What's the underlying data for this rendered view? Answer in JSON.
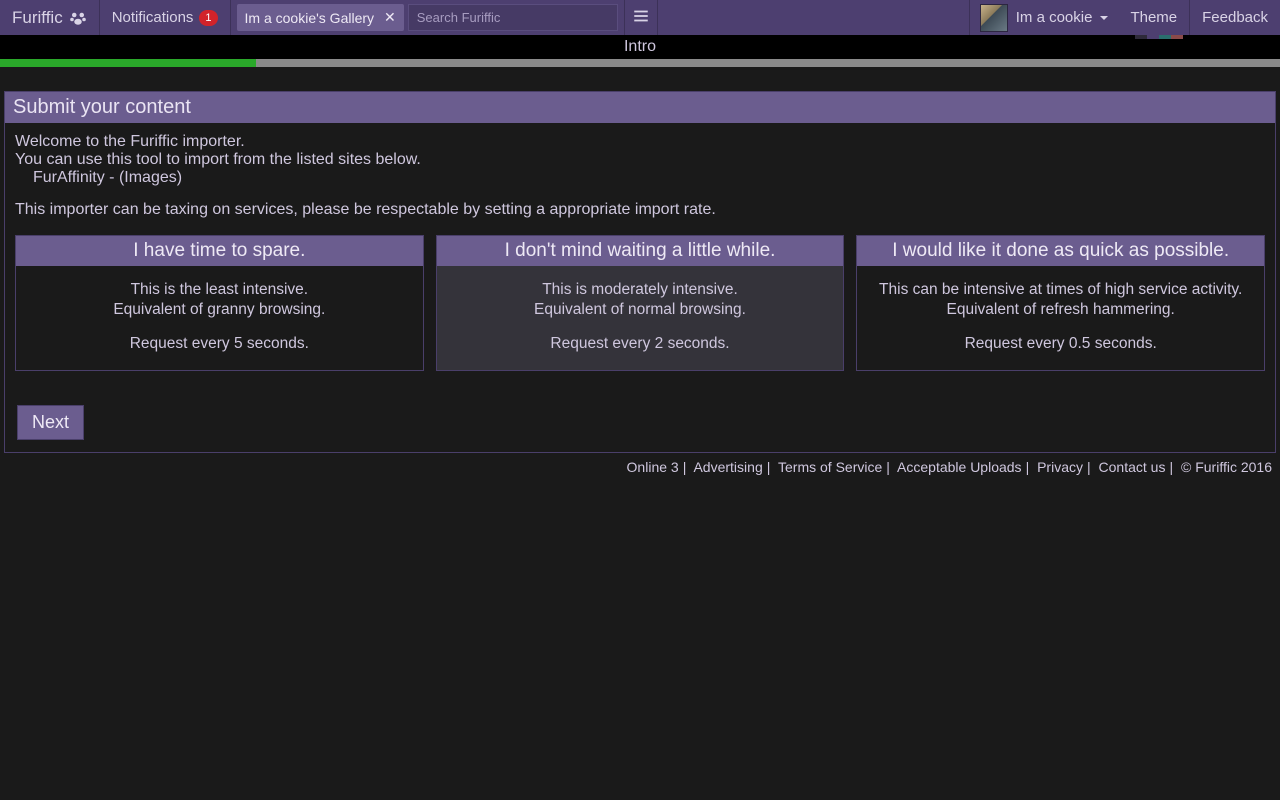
{
  "nav": {
    "brand": "Furiffic",
    "notifications_label": "Notifications",
    "notifications_count": "1",
    "tab_label": "Im a cookie's Gallery",
    "search_placeholder": "Search Furiffic",
    "username": "Im a cookie",
    "theme_label": "Theme",
    "feedback_label": "Feedback"
  },
  "intro_label": "Intro",
  "progress_percent": 20,
  "panel": {
    "title": "Submit your content",
    "line1": "Welcome to the Furiffic importer.",
    "line2": "You can use this tool to import from the listed sites below.",
    "site1": "FurAffinity - (Images)",
    "line3": "This importer can be taxing on services, please be respectable by setting a appropriate import rate."
  },
  "cards": [
    {
      "title": "I have time to spare.",
      "d1": "This is the least intensive.",
      "d2": "Equivalent of granny browsing.",
      "d3": "Request every 5 seconds."
    },
    {
      "title": "I don't mind waiting a little while.",
      "d1": "This is moderately intensive.",
      "d2": "Equivalent of normal browsing.",
      "d3": "Request every 2 seconds."
    },
    {
      "title": "I would like it done as quick as possible.",
      "d1": "This can be intensive at times of high service activity.",
      "d2": "Equivalent of refresh hammering.",
      "d3": "Request every 0.5 seconds."
    }
  ],
  "next_label": "Next",
  "footer": {
    "online": "Online 3",
    "advertising": "Advertising",
    "tos": "Terms of Service",
    "uploads": "Acceptable Uploads",
    "privacy": "Privacy",
    "contact": "Contact us",
    "copyright": "© Furiffic 2016"
  },
  "theme_colors": [
    "#2e2a3a",
    "#4d3f70",
    "#2a6e6e",
    "#8a4a4a"
  ]
}
